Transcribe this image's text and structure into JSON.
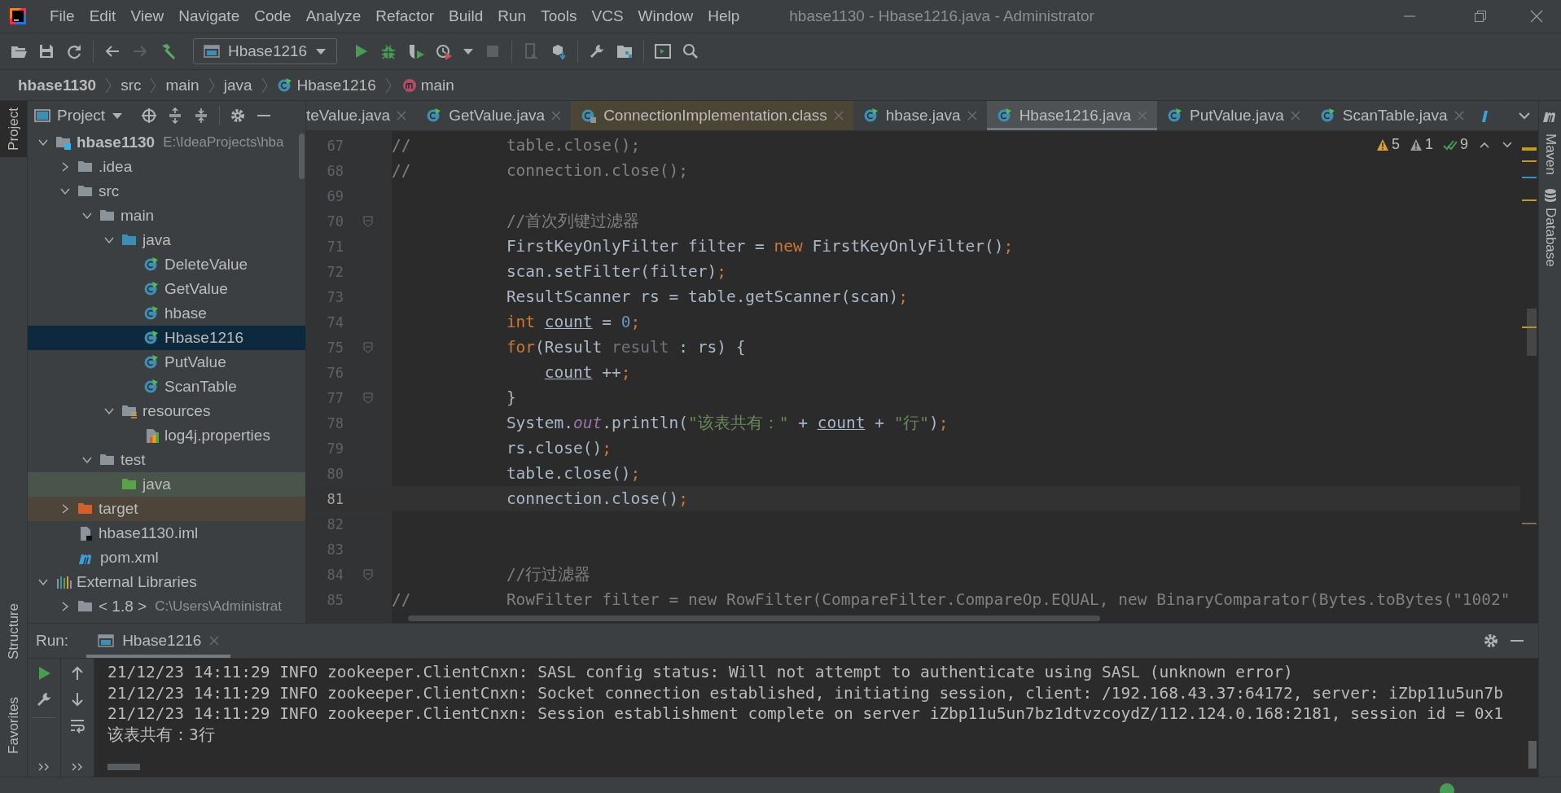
{
  "window": {
    "title": "hbase1130 - Hbase1216.java - Administrator"
  },
  "menu": [
    "File",
    "Edit",
    "View",
    "Navigate",
    "Code",
    "Analyze",
    "Refactor",
    "Build",
    "Run",
    "Tools",
    "VCS",
    "Window",
    "Help"
  ],
  "toolbar": {
    "run_config": "Hbase1216"
  },
  "breadcrumbs": [
    {
      "label": "hbase1130",
      "kind": "project"
    },
    {
      "label": "src",
      "kind": "folder"
    },
    {
      "label": "main",
      "kind": "folder"
    },
    {
      "label": "java",
      "kind": "folder"
    },
    {
      "label": "Hbase1216",
      "kind": "class"
    },
    {
      "label": "main",
      "kind": "method"
    }
  ],
  "left_stripe": [
    {
      "label": "Project",
      "selected": true
    },
    {
      "label": "Structure",
      "selected": false
    },
    {
      "label": "Favorites",
      "selected": false
    }
  ],
  "right_stripe": [
    {
      "label": "Maven"
    },
    {
      "label": "Database"
    }
  ],
  "project": {
    "title": "Project",
    "tree": [
      {
        "label": "hbase1130",
        "path": "E:\\IdeaProjects\\hba",
        "kind": "module",
        "expanded": true,
        "selected": false,
        "children": [
          {
            "label": ".idea",
            "kind": "folder",
            "expanded": false,
            "selected": false
          },
          {
            "label": "src",
            "kind": "folder",
            "expanded": true,
            "selected": false,
            "children": [
              {
                "label": "main",
                "kind": "folder",
                "expanded": true,
                "selected": false,
                "children": [
                  {
                    "label": "java",
                    "kind": "source",
                    "expanded": true,
                    "selected": false,
                    "children": [
                      {
                        "label": "DeleteValue",
                        "kind": "class",
                        "selected": false
                      },
                      {
                        "label": "GetValue",
                        "kind": "class",
                        "selected": false
                      },
                      {
                        "label": "hbase",
                        "kind": "class",
                        "selected": false
                      },
                      {
                        "label": "Hbase1216",
                        "kind": "class",
                        "selected": true
                      },
                      {
                        "label": "PutValue",
                        "kind": "class",
                        "selected": false
                      },
                      {
                        "label": "ScanTable",
                        "kind": "class",
                        "selected": false
                      }
                    ]
                  },
                  {
                    "label": "resources",
                    "kind": "resources",
                    "expanded": true,
                    "selected": false,
                    "children": [
                      {
                        "label": "log4j.properties",
                        "kind": "properties",
                        "selected": false
                      }
                    ]
                  }
                ]
              },
              {
                "label": "test",
                "kind": "folder",
                "expanded": true,
                "selected": false,
                "children": [
                  {
                    "label": "java",
                    "kind": "test",
                    "selected": false
                  }
                ]
              }
            ]
          },
          {
            "label": "target",
            "kind": "excluded",
            "expanded": false,
            "selected": false
          },
          {
            "label": "hbase1130.iml",
            "kind": "iml",
            "selected": false
          },
          {
            "label": "pom.xml",
            "kind": "pom",
            "selected": false
          }
        ]
      },
      {
        "label": "External Libraries",
        "kind": "libraries",
        "expanded": true,
        "selected": false,
        "children": [
          {
            "label": "< 1.8 >",
            "path": "C:\\Users\\Administrat",
            "kind": "jdk",
            "expanded": false,
            "selected": false
          }
        ]
      }
    ]
  },
  "editor": {
    "tabs": [
      {
        "label": "teValue.java",
        "kind": "partial",
        "selected": false
      },
      {
        "label": "GetValue.java",
        "kind": "java",
        "selected": false
      },
      {
        "label": "ConnectionImplementation.class",
        "kind": "compiled",
        "selected": false
      },
      {
        "label": "hbase.java",
        "kind": "java",
        "selected": false
      },
      {
        "label": "Hbase1216.java",
        "kind": "java",
        "selected": true
      },
      {
        "label": "PutValue.java",
        "kind": "java",
        "selected": false
      },
      {
        "label": "ScanTable.java",
        "kind": "java",
        "selected": false
      }
    ],
    "inspections": {
      "warnings": "5",
      "weak_warnings": "1",
      "passed": "9"
    },
    "lines": [
      {
        "n": "67",
        "kind": "commented",
        "current": false,
        "fold": false,
        "tokens": [
          {
            "kind": "comment",
            "text": "//"
          },
          {
            "kind": "comment",
            "text": "table.close();"
          }
        ]
      },
      {
        "n": "68",
        "kind": "commented",
        "current": false,
        "fold": false,
        "tokens": [
          {
            "kind": "comment",
            "text": "//"
          },
          {
            "kind": "comment",
            "text": "connection.close();"
          }
        ]
      },
      {
        "n": "69",
        "kind": "blank",
        "current": false,
        "fold": false
      },
      {
        "n": "70",
        "kind": "body",
        "current": false,
        "fold": true,
        "tokens": [
          {
            "kind": "comment",
            "text": "//首次列键过滤器"
          }
        ]
      },
      {
        "n": "71",
        "kind": "body",
        "current": false,
        "fold": false,
        "tokens": [
          {
            "kind": "plain",
            "text": "FirstKeyOnlyFilter filter = "
          },
          {
            "kind": "keyword",
            "text": "new"
          },
          {
            "kind": "plain",
            "text": " FirstKeyOnlyFilter()"
          },
          {
            "kind": "keyword",
            "text": ";"
          }
        ]
      },
      {
        "n": "72",
        "kind": "body",
        "current": false,
        "fold": false,
        "tokens": [
          {
            "kind": "plain",
            "text": "scan.setFilter(filter)"
          },
          {
            "kind": "keyword",
            "text": ";"
          }
        ]
      },
      {
        "n": "73",
        "kind": "body",
        "current": false,
        "fold": false,
        "tokens": [
          {
            "kind": "plain",
            "text": "ResultScanner rs = table.getScanner(scan)"
          },
          {
            "kind": "keyword",
            "text": ";"
          }
        ]
      },
      {
        "n": "74",
        "kind": "body",
        "current": false,
        "fold": false,
        "tokens": [
          {
            "kind": "keyword",
            "text": "int "
          },
          {
            "kind": "variable",
            "text": "count"
          },
          {
            "kind": "plain",
            "text": " = "
          },
          {
            "kind": "number",
            "text": "0"
          },
          {
            "kind": "keyword",
            "text": ";"
          }
        ]
      },
      {
        "n": "75",
        "kind": "body",
        "current": false,
        "fold": true,
        "tokens": [
          {
            "kind": "keyword",
            "text": "for"
          },
          {
            "kind": "plain",
            "text": "(Result "
          },
          {
            "kind": "unused",
            "text": "result"
          },
          {
            "kind": "plain",
            "text": " : rs) {"
          }
        ]
      },
      {
        "n": "76",
        "kind": "nested",
        "current": false,
        "fold": false,
        "tokens": [
          {
            "kind": "variable",
            "text": "count"
          },
          {
            "kind": "plain",
            "text": " ++"
          },
          {
            "kind": "keyword",
            "text": ";"
          }
        ]
      },
      {
        "n": "77",
        "kind": "body",
        "current": false,
        "fold": true,
        "tokens": [
          {
            "kind": "plain",
            "text": "}"
          }
        ]
      },
      {
        "n": "78",
        "kind": "body",
        "current": false,
        "fold": false,
        "tokens": [
          {
            "kind": "plain",
            "text": "System."
          },
          {
            "kind": "field",
            "text": "out"
          },
          {
            "kind": "plain",
            "text": ".println("
          },
          {
            "kind": "string",
            "text": "\"该表共有：\""
          },
          {
            "kind": "plain",
            "text": " + "
          },
          {
            "kind": "variable",
            "text": "count"
          },
          {
            "kind": "plain",
            "text": " + "
          },
          {
            "kind": "string",
            "text": "\"行\""
          },
          {
            "kind": "plain",
            "text": ")"
          },
          {
            "kind": "keyword",
            "text": ";"
          }
        ]
      },
      {
        "n": "79",
        "kind": "body",
        "current": false,
        "fold": false,
        "tokens": [
          {
            "kind": "plain",
            "text": "rs.close()"
          },
          {
            "kind": "keyword",
            "text": ";"
          }
        ]
      },
      {
        "n": "80",
        "kind": "body",
        "current": false,
        "fold": false,
        "tokens": [
          {
            "kind": "plain",
            "text": "table.close()"
          },
          {
            "kind": "keyword",
            "text": ";"
          }
        ]
      },
      {
        "n": "81",
        "kind": "body",
        "current": true,
        "fold": false,
        "tokens": [
          {
            "kind": "plain",
            "text": "connection.close()"
          },
          {
            "kind": "keyword",
            "text": ";"
          }
        ]
      },
      {
        "n": "82",
        "kind": "blank",
        "current": false,
        "fold": false
      },
      {
        "n": "83",
        "kind": "blank",
        "current": false,
        "fold": false
      },
      {
        "n": "84",
        "kind": "body",
        "current": false,
        "fold": true,
        "tokens": [
          {
            "kind": "comment",
            "text": "//行过滤器"
          }
        ]
      },
      {
        "n": "85",
        "kind": "commented",
        "current": false,
        "fold": false,
        "tokens": [
          {
            "kind": "comment",
            "text": "//"
          },
          {
            "kind": "comment",
            "text": "RowFilter filter = new RowFilter(CompareFilter.CompareOp.EQUAL, new BinaryComparator(Bytes.toBytes(\"1002\""
          }
        ]
      }
    ]
  },
  "run": {
    "label": "Run:",
    "tabs": [
      {
        "label": "Hbase1216",
        "selected": true
      }
    ],
    "console": [
      "21/12/23 14:11:29 INFO zookeeper.ClientCnxn: SASL config status: Will not attempt to authenticate using SASL (unknown error)",
      "21/12/23 14:11:29 INFO zookeeper.ClientCnxn: Socket connection established, initiating session, client: /192.168.43.37:64172, server: iZbp11u5un7b",
      "21/12/23 14:11:29 INFO zookeeper.ClientCnxn: Session establishment complete on server iZbp11u5un7bz1dtvzcoydZ/112.124.0.168:2181, session id = 0x1",
      "该表共有：3行"
    ]
  }
}
